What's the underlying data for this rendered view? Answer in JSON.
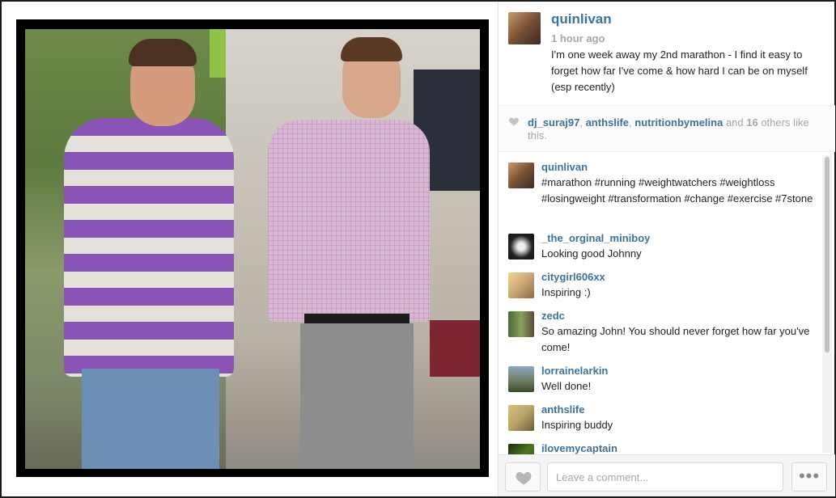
{
  "post": {
    "username": "quinlivan",
    "time": "1 hour ago",
    "caption": "I'm one week away my 2nd marathon - I find it easy to forget how far I've come & how hard I can be on myself (esp recently)"
  },
  "likes": {
    "users": [
      "dj_suraj97",
      "anthslife",
      "nutritionbymelina"
    ],
    "sep1": ", ",
    "sep2": ", ",
    "and": " and ",
    "others_count": "16",
    "others_suffix": " others like this."
  },
  "comments": [
    {
      "user": "quinlivan",
      "text": "#marathon #running #weightwatchers #weightloss #losingweight #transformation #change #exercise #7stone",
      "avatar_color": "#7a5035"
    },
    {
      "user": "_the_orginal_miniboy",
      "text": "Looking good Johnny",
      "avatar_color": "#3a3a3a"
    },
    {
      "user": "citygirl606xx",
      "text": "Inspiring :)",
      "avatar_color": "#c9a775"
    },
    {
      "user": "zedc",
      "text": "So amazing John! You should never forget how far you've come!",
      "avatar_color": "#5a6a3a"
    },
    {
      "user": "lorrainelarkin",
      "text": "Well done!",
      "avatar_color": "#6c7a5a"
    },
    {
      "user": "anthslife",
      "text": "Inspiring buddy",
      "avatar_color": "#b8a46a"
    },
    {
      "user": "ilovemycaptain",
      "text": "",
      "avatar_color": "#2f4a1e"
    }
  ],
  "footer": {
    "comment_placeholder": "Leave a comment...",
    "more_label": "•••"
  },
  "colors": {
    "link": "#3f729b",
    "muted": "#a5a7aa"
  },
  "icons": {
    "like": "heart-icon",
    "likes_indicator": "heart-icon",
    "more": "ellipsis-icon"
  }
}
